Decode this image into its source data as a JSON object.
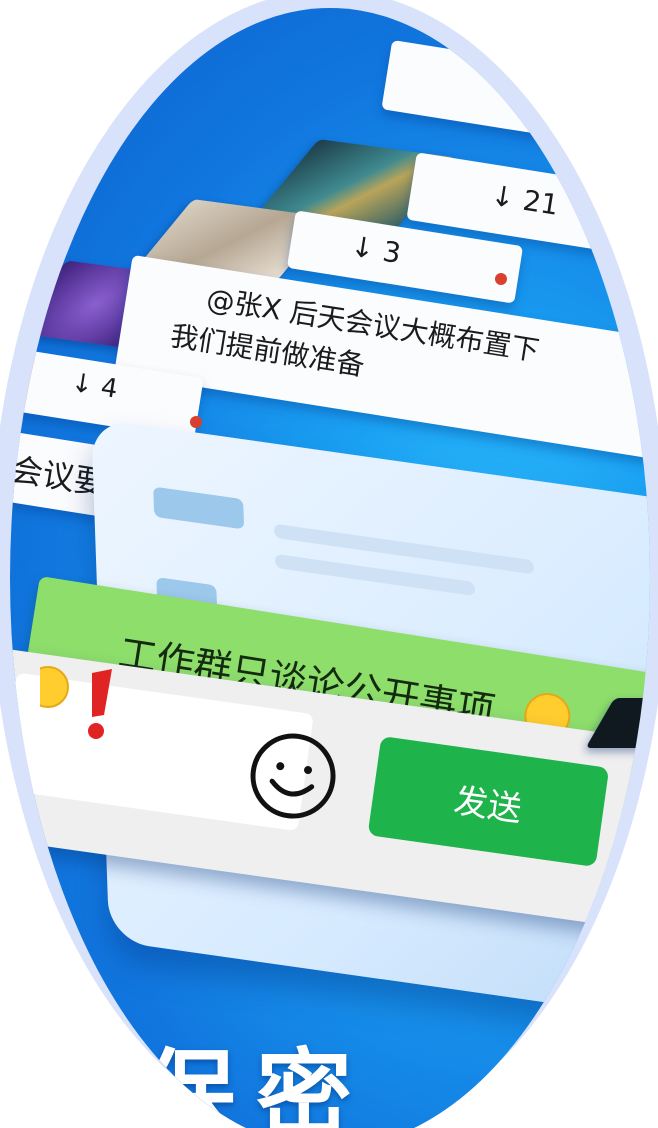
{
  "messages": [
    {
      "id": "back",
      "text": "<"
    },
    {
      "id": "count_21",
      "text": "↓ 21"
    },
    {
      "id": "count_3",
      "text": "↓ 3"
    },
    {
      "id": "mention",
      "line1": "@张X 后天会议大概布置下",
      "line2": "我们提前做准备"
    },
    {
      "id": "count_4",
      "text": "↓ 4"
    },
    {
      "id": "meeting_points",
      "text": "会议要点"
    },
    {
      "id": "work_group",
      "text": "工作群只谈论公开事项"
    }
  ],
  "input": {
    "send_label": "发送",
    "emoji_icon": "smiley-face-icon",
    "exclaim_icon": "exclamation-icon"
  },
  "banner": {
    "text": "保密"
  },
  "colors": {
    "accent_blue": "#1177df",
    "bubble_green": "#8ede6c",
    "send_green": "#1fb34c",
    "halo": "#d9e2fb"
  }
}
